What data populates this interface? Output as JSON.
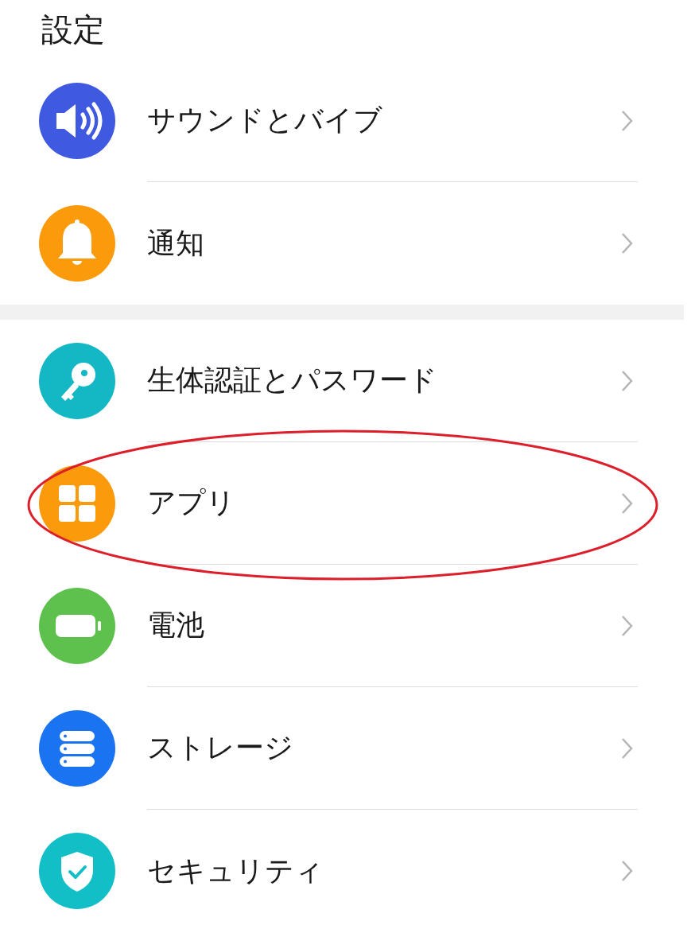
{
  "title": "設定",
  "groups": [
    {
      "items": [
        {
          "label": "サウンドとバイブ",
          "kind": "speaker",
          "color": "#3f5ae0"
        },
        {
          "label": "通知",
          "kind": "bell",
          "color": "#fb9a0b"
        }
      ]
    },
    {
      "items": [
        {
          "label": "生体認証とパスワード",
          "kind": "key",
          "color": "#14b8c4"
        },
        {
          "label": "アプリ",
          "kind": "grid",
          "color": "#fb9a0b",
          "highlighted": true
        },
        {
          "label": "電池",
          "kind": "battery",
          "color": "#5ec14e"
        },
        {
          "label": "ストレージ",
          "kind": "storage",
          "color": "#1a73f0"
        },
        {
          "label": "セキュリティ",
          "kind": "shield",
          "color": "#13bfc7"
        }
      ]
    }
  ]
}
